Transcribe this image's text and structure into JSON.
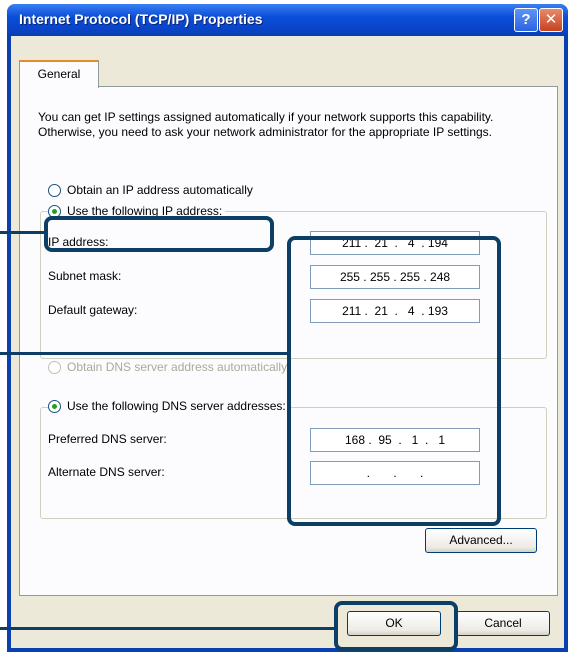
{
  "window": {
    "title": "Internet Protocol (TCP/IP) Properties",
    "help_glyph": "?",
    "close_glyph": "✕"
  },
  "tabs": [
    {
      "label": "General",
      "selected": true
    }
  ],
  "description": "You can get IP settings assigned automatically if your network supports this capability. Otherwise, you need to ask your network administrator for the appropriate IP settings.",
  "ip_mode": {
    "auto_label": "Obtain an IP address automatically",
    "manual_label": "Use the following IP address:",
    "selected": "manual"
  },
  "ip_fields": {
    "ip_label": "IP address:",
    "ip_value": "211 .  21  .   4  . 194",
    "mask_label": "Subnet mask:",
    "mask_value": "255 . 255 . 255 . 248",
    "gateway_label": "Default gateway:",
    "gateway_value": "211 .  21  .   4  . 193"
  },
  "dns_mode": {
    "auto_label": "Obtain DNS server address automatically",
    "manual_label": "Use the following DNS server addresses:",
    "selected": "manual"
  },
  "dns_fields": {
    "preferred_label": "Preferred DNS server:",
    "preferred_value": "168 .  95  .   1  .   1",
    "alternate_label": "Alternate DNS server:",
    "alternate_value": "     .       .       .     "
  },
  "buttons": {
    "advanced": "Advanced...",
    "ok": "OK",
    "cancel": "Cancel"
  },
  "colors": {
    "titlebar": "#0a3fb0",
    "dialog_bg": "#ece9d8",
    "callout": "#0d3f66"
  }
}
